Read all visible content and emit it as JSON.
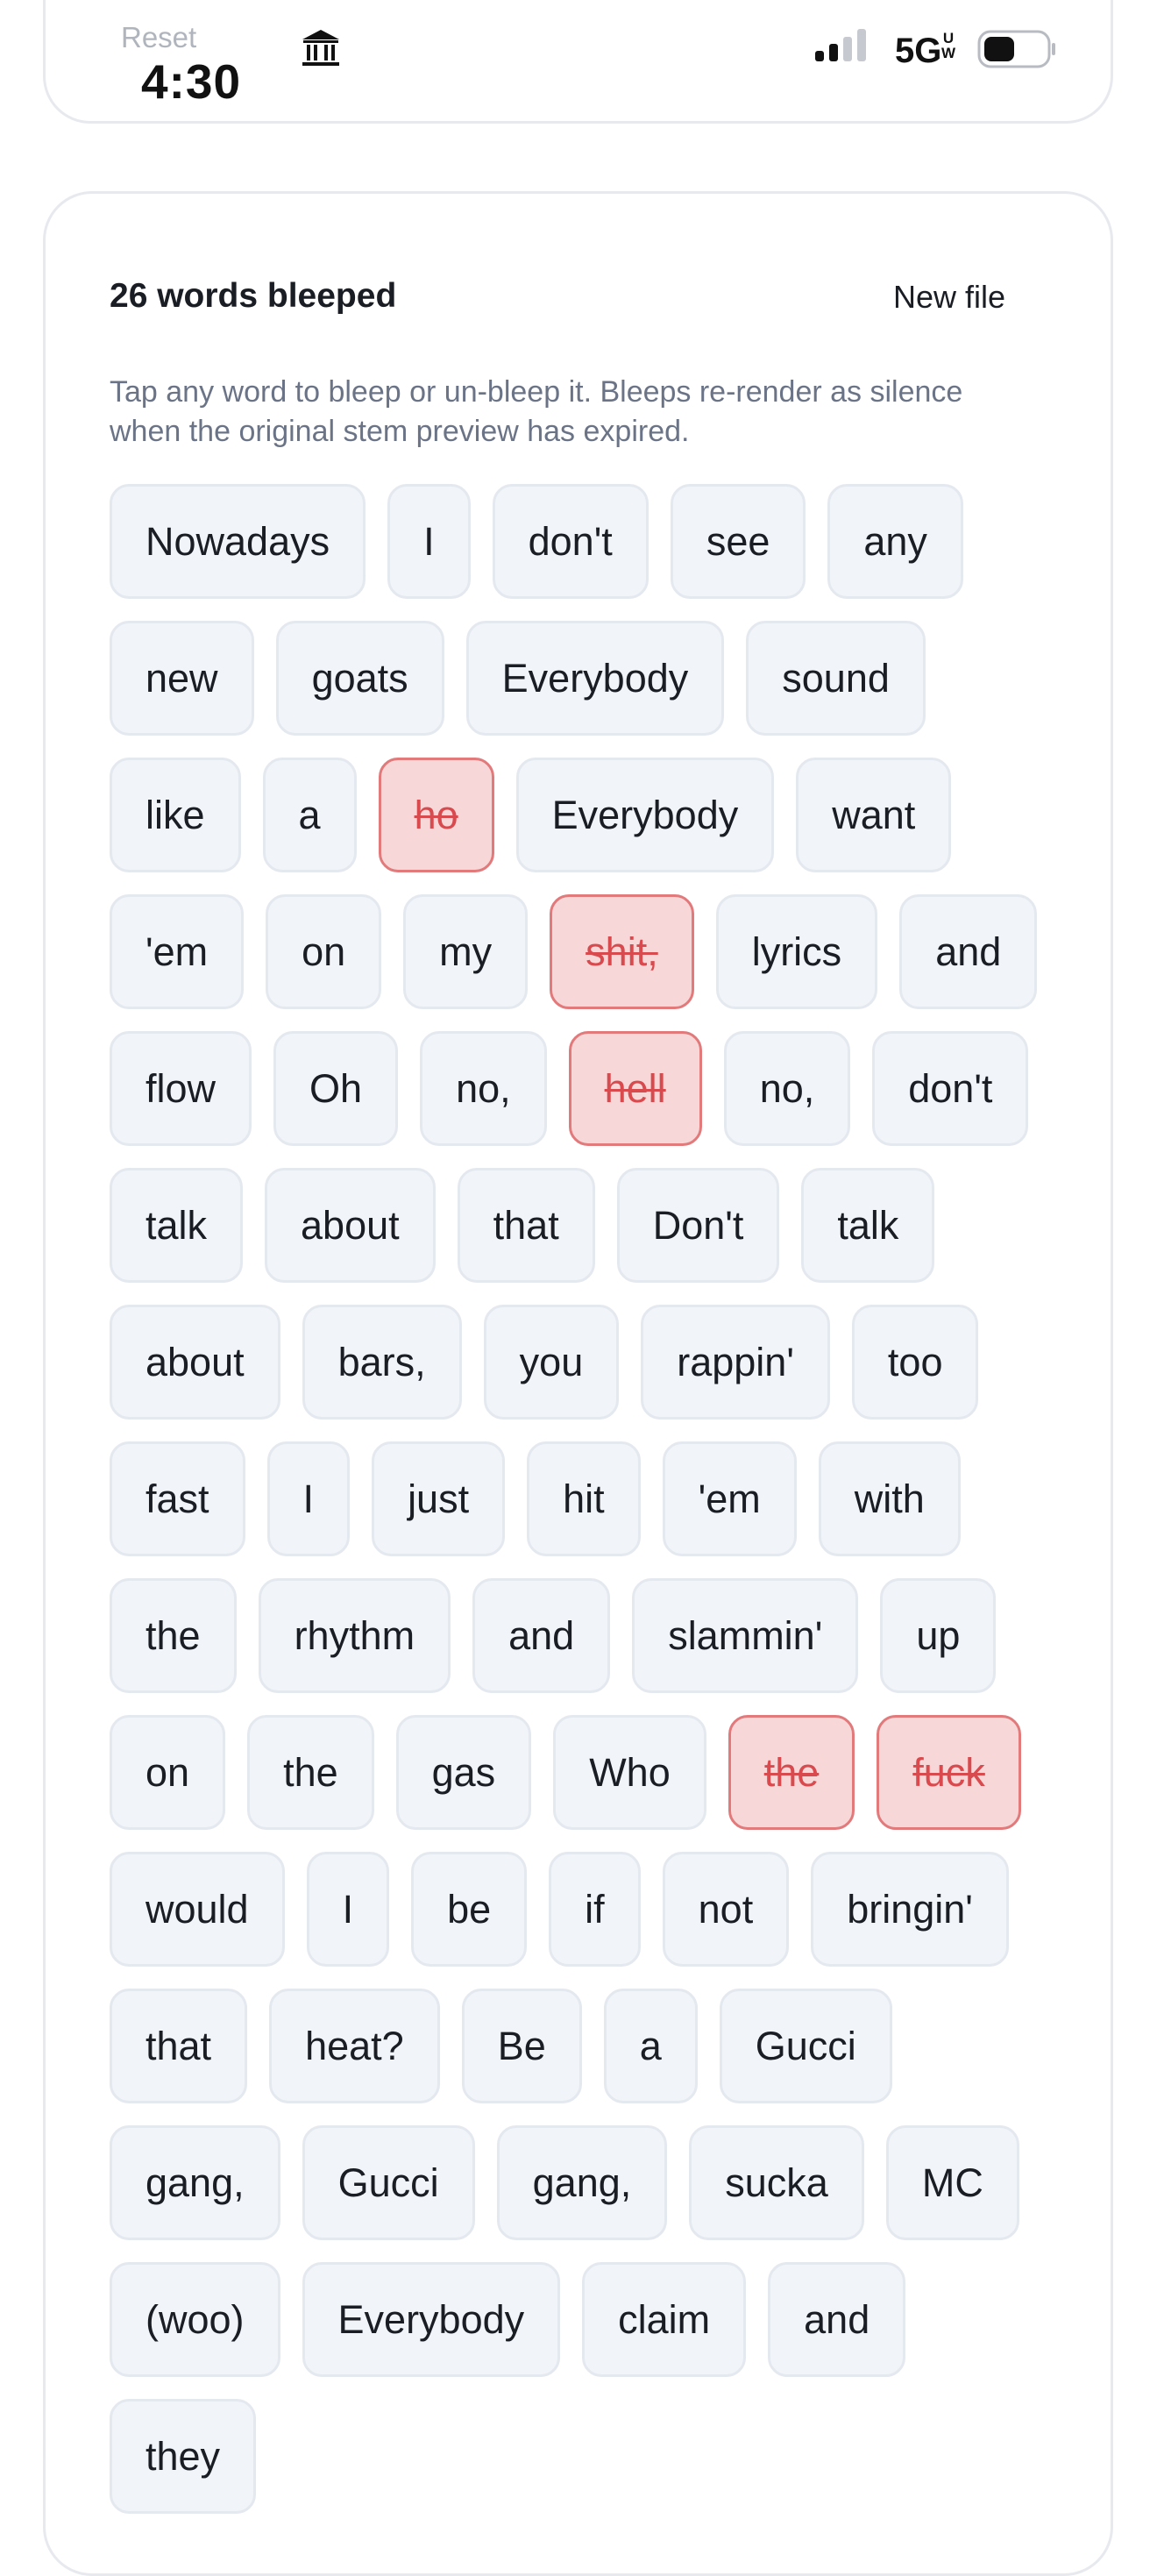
{
  "status_bar": {
    "reset_label": "Reset",
    "time": "4:30",
    "network": "5G",
    "network_badge_top": "U",
    "network_badge_bottom": "W"
  },
  "card": {
    "title": "26 words bleeped",
    "new_file_label": "New file",
    "help_text": "Tap any word to bleep or un-bleep it. Bleeps re-render as silence when the original stem preview has expired."
  },
  "colors": {
    "bleeped_bg": "#f8d7d8",
    "bleeped_border": "#e2797b",
    "bleeped_text": "#d84a4d",
    "chip_bg": "#f1f4f9",
    "chip_border": "#e4e8ef"
  },
  "words": [
    {
      "text": "Nowadays",
      "bleeped": false
    },
    {
      "text": "I",
      "bleeped": false
    },
    {
      "text": "don't",
      "bleeped": false
    },
    {
      "text": "see",
      "bleeped": false
    },
    {
      "text": "any",
      "bleeped": false
    },
    {
      "text": "new",
      "bleeped": false
    },
    {
      "text": "goats",
      "bleeped": false
    },
    {
      "text": "Everybody",
      "bleeped": false
    },
    {
      "text": "sound",
      "bleeped": false
    },
    {
      "text": "like",
      "bleeped": false
    },
    {
      "text": "a",
      "bleeped": false
    },
    {
      "text": "ho",
      "bleeped": true
    },
    {
      "text": "Everybody",
      "bleeped": false
    },
    {
      "text": "want",
      "bleeped": false
    },
    {
      "text": "'em",
      "bleeped": false
    },
    {
      "text": "on",
      "bleeped": false
    },
    {
      "text": "my",
      "bleeped": false
    },
    {
      "text": "shit,",
      "bleeped": true
    },
    {
      "text": "lyrics",
      "bleeped": false
    },
    {
      "text": "and",
      "bleeped": false
    },
    {
      "text": "flow",
      "bleeped": false
    },
    {
      "text": "Oh",
      "bleeped": false
    },
    {
      "text": "no,",
      "bleeped": false
    },
    {
      "text": "hell",
      "bleeped": true
    },
    {
      "text": "no,",
      "bleeped": false
    },
    {
      "text": "don't",
      "bleeped": false
    },
    {
      "text": "talk",
      "bleeped": false
    },
    {
      "text": "about",
      "bleeped": false
    },
    {
      "text": "that",
      "bleeped": false
    },
    {
      "text": "Don't",
      "bleeped": false
    },
    {
      "text": "talk",
      "bleeped": false
    },
    {
      "text": "about",
      "bleeped": false
    },
    {
      "text": "bars,",
      "bleeped": false
    },
    {
      "text": "you",
      "bleeped": false
    },
    {
      "text": "rappin'",
      "bleeped": false
    },
    {
      "text": "too",
      "bleeped": false
    },
    {
      "text": "fast",
      "bleeped": false
    },
    {
      "text": "I",
      "bleeped": false
    },
    {
      "text": "just",
      "bleeped": false
    },
    {
      "text": "hit",
      "bleeped": false
    },
    {
      "text": "'em",
      "bleeped": false
    },
    {
      "text": "with",
      "bleeped": false
    },
    {
      "text": "the",
      "bleeped": false
    },
    {
      "text": "rhythm",
      "bleeped": false
    },
    {
      "text": "and",
      "bleeped": false
    },
    {
      "text": "slammin'",
      "bleeped": false
    },
    {
      "text": "up",
      "bleeped": false
    },
    {
      "text": "on",
      "bleeped": false
    },
    {
      "text": "the",
      "bleeped": false
    },
    {
      "text": "gas",
      "bleeped": false
    },
    {
      "text": "Who",
      "bleeped": false
    },
    {
      "text": "the",
      "bleeped": true
    },
    {
      "text": "fuck",
      "bleeped": true
    },
    {
      "text": "would",
      "bleeped": false
    },
    {
      "text": "I",
      "bleeped": false
    },
    {
      "text": "be",
      "bleeped": false
    },
    {
      "text": "if",
      "bleeped": false
    },
    {
      "text": "not",
      "bleeped": false
    },
    {
      "text": "bringin'",
      "bleeped": false
    },
    {
      "text": "that",
      "bleeped": false
    },
    {
      "text": "heat?",
      "bleeped": false
    },
    {
      "text": "Be",
      "bleeped": false
    },
    {
      "text": "a",
      "bleeped": false
    },
    {
      "text": "Gucci",
      "bleeped": false
    },
    {
      "text": "gang,",
      "bleeped": false
    },
    {
      "text": "Gucci",
      "bleeped": false
    },
    {
      "text": "gang,",
      "bleeped": false
    },
    {
      "text": "sucka",
      "bleeped": false
    },
    {
      "text": "MC",
      "bleeped": false
    },
    {
      "text": "(woo)",
      "bleeped": false
    },
    {
      "text": "Everybody",
      "bleeped": false
    },
    {
      "text": "claim",
      "bleeped": false
    },
    {
      "text": "and",
      "bleeped": false
    },
    {
      "text": "they",
      "bleeped": false
    }
  ]
}
